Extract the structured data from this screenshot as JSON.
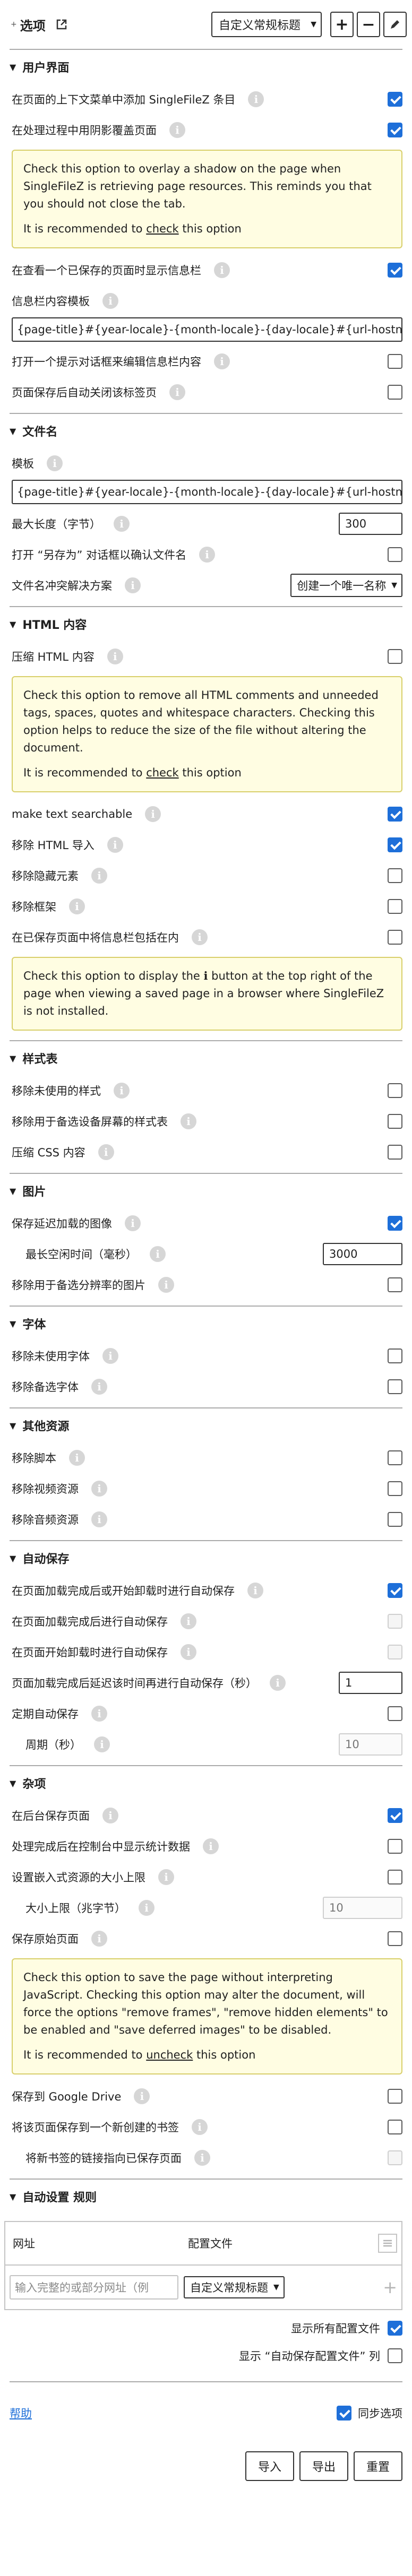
{
  "header": {
    "title": "选项",
    "profile_selected": "自定义常规标题",
    "add_label": "+",
    "remove_label": "−"
  },
  "colors": {
    "accent": "#1e6fd9",
    "note_bg": "#fffde2",
    "note_border": "#d8cf6a"
  },
  "info_glyph": "i",
  "sections": {
    "user_interface": {
      "title": "用户界面",
      "rows": [
        {
          "label": "在页面的上下文菜单中添加 SingleFileZ 条目",
          "checked": true
        },
        {
          "label": "在处理过程中用阴影覆盖页面",
          "checked": true
        },
        {
          "label": "在查看一个已保存的页面时显示信息栏",
          "checked": true
        },
        {
          "label": "信息栏内容模板"
        },
        {
          "label": "打开一个提示对话框来编辑信息栏内容",
          "checked": false
        },
        {
          "label": "页面保存后自动关闭该标签页",
          "checked": false
        }
      ],
      "note": {
        "text": "Check this option to overlay a shadow on the page when SingleFileZ is retrieving page resources. This reminds you that you should not close the tab.",
        "rec_prefix": "It is recommended to ",
        "rec_link": "check",
        "rec_suffix": " this option"
      },
      "infobar_template": "{page-title}#{year-locale}-{month-locale}-{day-locale}#{url-hostname}"
    },
    "filename": {
      "title": "文件名",
      "template_label": "模板",
      "template_value": "{page-title}#{year-locale}-{month-locale}-{day-locale}#{url-hostname}",
      "maxlen_label": "最大长度（字节）",
      "maxlen_value": "300",
      "confirm_label": "打开 “另存为” 对话框以确认文件名",
      "confirm_checked": false,
      "conflict_label": "文件名冲突解决方案",
      "conflict_value": "创建一个唯一名称"
    },
    "html": {
      "title": "HTML 内容",
      "compress_label": "压缩 HTML 内容",
      "compress_checked": false,
      "note1": {
        "text": "Check this option to remove all HTML comments and unneeded tags, spaces, quotes and whitespace characters. Checking this option helps to reduce the size of the file without altering the document.",
        "rec_prefix": "It is recommended to ",
        "rec_link": "check",
        "rec_suffix": " this option"
      },
      "rows": [
        {
          "label": "make text searchable",
          "checked": true
        },
        {
          "label": "移除 HTML 导入",
          "checked": true
        },
        {
          "label": "移除隐藏元素",
          "checked": false
        },
        {
          "label": "移除框架",
          "checked": false
        },
        {
          "label": "在已保存页面中将信息栏包括在内",
          "checked": false
        }
      ],
      "note2": {
        "pre": "Check this option to display the ",
        "glyph": "ℹ",
        "post": " button at the top right of the page when viewing a saved page in a browser where SingleFileZ is not installed."
      }
    },
    "stylesheets": {
      "title": "样式表",
      "rows": [
        {
          "label": "移除未使用的样式",
          "checked": false
        },
        {
          "label": "移除用于备选设备屏幕的样式表",
          "checked": false
        },
        {
          "label": "压缩 CSS 内容",
          "checked": false
        }
      ]
    },
    "images": {
      "title": "图片",
      "lazy_label": "保存延迟加载的图像",
      "lazy_checked": true,
      "idle_label": "最长空闲时间（毫秒）",
      "idle_value": "3000",
      "altres_label": "移除用于备选分辨率的图片",
      "altres_checked": false
    },
    "fonts": {
      "title": "字体",
      "rows": [
        {
          "label": "移除未使用字体",
          "checked": false
        },
        {
          "label": "移除备选字体",
          "checked": false
        }
      ]
    },
    "other": {
      "title": "其他资源",
      "rows": [
        {
          "label": "移除脚本",
          "checked": false
        },
        {
          "label": "移除视频资源",
          "checked": false
        },
        {
          "label": "移除音频资源",
          "checked": false
        }
      ]
    },
    "autosave": {
      "title": "自动保存",
      "rows": [
        {
          "label": "在页面加载完成后或开始卸载时进行自动保存",
          "checked": true
        },
        {
          "label": "在页面加载完成后进行自动保存",
          "checked": false,
          "disabled": true
        },
        {
          "label": "在页面开始卸载时进行自动保存",
          "checked": false,
          "disabled": true
        }
      ],
      "delay_label": "页面加载完成后延迟该时间再进行自动保存（秒）",
      "delay_value": "1",
      "periodic_label": "定期自动保存",
      "periodic_checked": false,
      "period_label": "周期（秒）",
      "period_value": "10"
    },
    "misc": {
      "title": "杂项",
      "rows": [
        {
          "label": "在后台保存页面",
          "checked": true
        },
        {
          "label": "处理完成后在控制台中显示统计数据",
          "checked": false
        },
        {
          "label": "设置嵌入式资源的大小上限",
          "checked": false
        }
      ],
      "maxsize_label": "大小上限（兆字节）",
      "maxsize_value": "10",
      "original_label": "保存原始页面",
      "original_checked": false,
      "note": {
        "text": "Check this option to save the page without interpreting JavaScript. Checking this option may alter the document, will force the options \"remove frames\", \"remove hidden elements\" to be enabled and \"save deferred images\" to be disabled.",
        "rec_prefix": "It is recommended to ",
        "rec_link": "uncheck",
        "rec_suffix": " this option"
      },
      "rows2": [
        {
          "label": "保存到 Google Drive",
          "checked": false
        },
        {
          "label": "将该页面保存到一个新创建的书签",
          "checked": false
        }
      ],
      "bookmark_label": "将新书签的链接指向已保存页面",
      "bookmark_checked": false
    },
    "rules": {
      "title": "自动设置 规则",
      "col_url": "网址",
      "col_profile": "配置文件",
      "url_placeholder": "输入完整的或部分网址（例",
      "profile_value": "自定义常规标题",
      "show_all_label": "显示所有配置文件",
      "show_all_checked": true,
      "show_autosave_label": "显示 “自动保存配置文件” 列",
      "show_autosave_checked": false
    }
  },
  "footer": {
    "help": "帮助",
    "sync_label": "同步选项",
    "sync_checked": true,
    "import": "导入",
    "export": "导出",
    "reset": "重置"
  }
}
